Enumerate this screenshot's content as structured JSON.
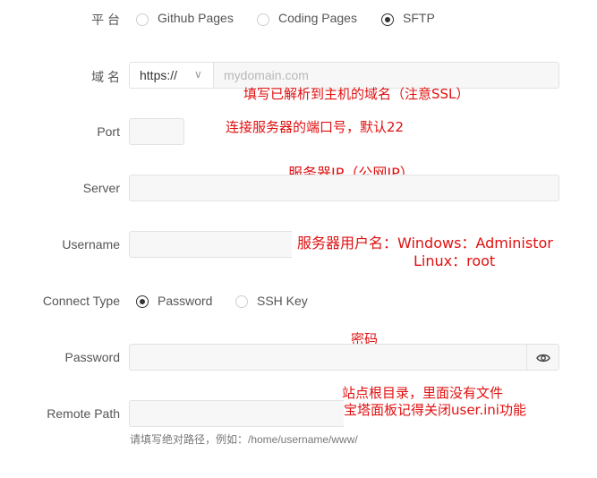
{
  "platform": {
    "label": "平 台",
    "options": [
      "Github Pages",
      "Coding Pages",
      "SFTP"
    ],
    "selected": "SFTP"
  },
  "domain": {
    "label": "域 名",
    "protocol": "https://",
    "protocol_chevron": "∨",
    "placeholder": "mydomain.com",
    "annotation": "填写已解析到主机的域名（注意SSL）"
  },
  "port": {
    "label": "Port",
    "value": "",
    "annotation": "连接服务器的端口号，默认22"
  },
  "server": {
    "label": "Server",
    "value": "",
    "annotation": "服务器IP（公网IP）"
  },
  "username": {
    "label": "Username",
    "value": "",
    "annotation_line1": "服务器用户名：Windows：Administor",
    "annotation_line2": "Linux：root"
  },
  "connect_type": {
    "label": "Connect Type",
    "options": [
      "Password",
      "SSH Key"
    ],
    "selected": "Password"
  },
  "password": {
    "label": "Password",
    "value": "",
    "annotation": "密码",
    "toggle_icon": "eye-icon"
  },
  "remote_path": {
    "label": "Remote Path",
    "value": "",
    "hint": "请填写绝对路径，例如：/home/username/www/",
    "annotation_line1": "站点根目录，里面没有文件",
    "annotation_line2": "宝塔面板记得关闭user.ini功能"
  }
}
